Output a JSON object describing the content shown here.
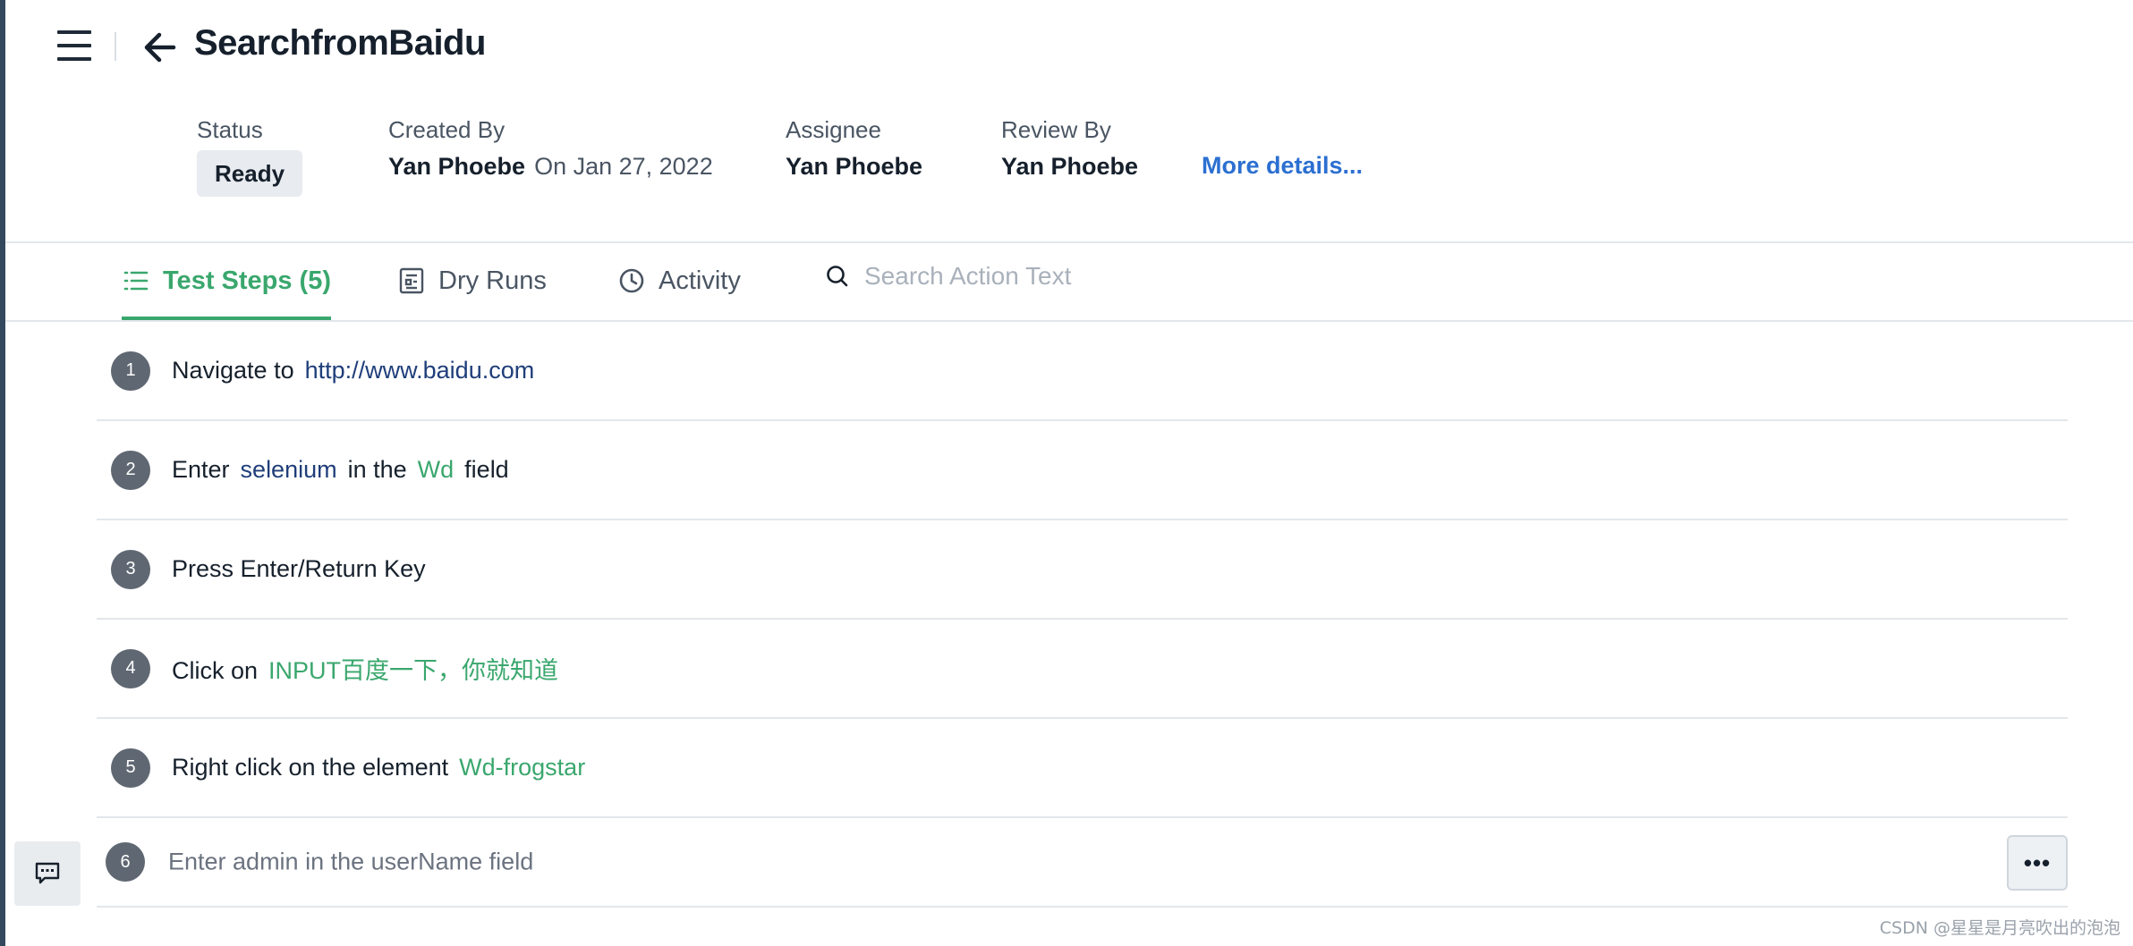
{
  "header": {
    "title": "SearchfromBaidu",
    "meta": {
      "status_label": "Status",
      "status_value": "Ready",
      "created_by_label": "Created By",
      "created_by_value": "Yan Phoebe",
      "created_on": "On Jan 27, 2022",
      "assignee_label": "Assignee",
      "assignee_value": "Yan Phoebe",
      "review_by_label": "Review By",
      "review_by_value": "Yan Phoebe",
      "more_details": "More details..."
    }
  },
  "tabs": [
    {
      "label": "Test Steps (5)",
      "active": true,
      "icon": "list-icon"
    },
    {
      "label": "Dry Runs",
      "active": false,
      "icon": "report-icon"
    },
    {
      "label": "Activity",
      "active": false,
      "icon": "clock-icon"
    }
  ],
  "search": {
    "placeholder": "Search Action Text",
    "value": ""
  },
  "steps": [
    {
      "number": "1",
      "tokens": [
        {
          "text": "Navigate to",
          "kind": "plain"
        },
        {
          "text": "http://www.baidu.com",
          "kind": "link"
        }
      ]
    },
    {
      "number": "2",
      "tokens": [
        {
          "text": "Enter",
          "kind": "plain"
        },
        {
          "text": "selenium",
          "kind": "link"
        },
        {
          "text": "in the",
          "kind": "plain"
        },
        {
          "text": "Wd",
          "kind": "green"
        },
        {
          "text": "field",
          "kind": "plain"
        }
      ]
    },
    {
      "number": "3",
      "tokens": [
        {
          "text": "Press Enter/Return Key",
          "kind": "plain"
        }
      ]
    },
    {
      "number": "4",
      "tokens": [
        {
          "text": "Click on",
          "kind": "plain"
        },
        {
          "text": "INPUT百度一下，你就知道",
          "kind": "green"
        }
      ]
    },
    {
      "number": "5",
      "tokens": [
        {
          "text": "Right click on the element",
          "kind": "plain"
        },
        {
          "text": "Wd-frogstar",
          "kind": "green"
        }
      ]
    }
  ],
  "new_step": {
    "number": "6",
    "placeholder": "Enter admin in the userName field",
    "more_label": "•••"
  },
  "colors": {
    "accent": "#3aa76d",
    "link": "#2c6fd1",
    "step_badge": "#5f6772"
  },
  "watermark": "CSDN @星星是月亮吹出的泡泡"
}
